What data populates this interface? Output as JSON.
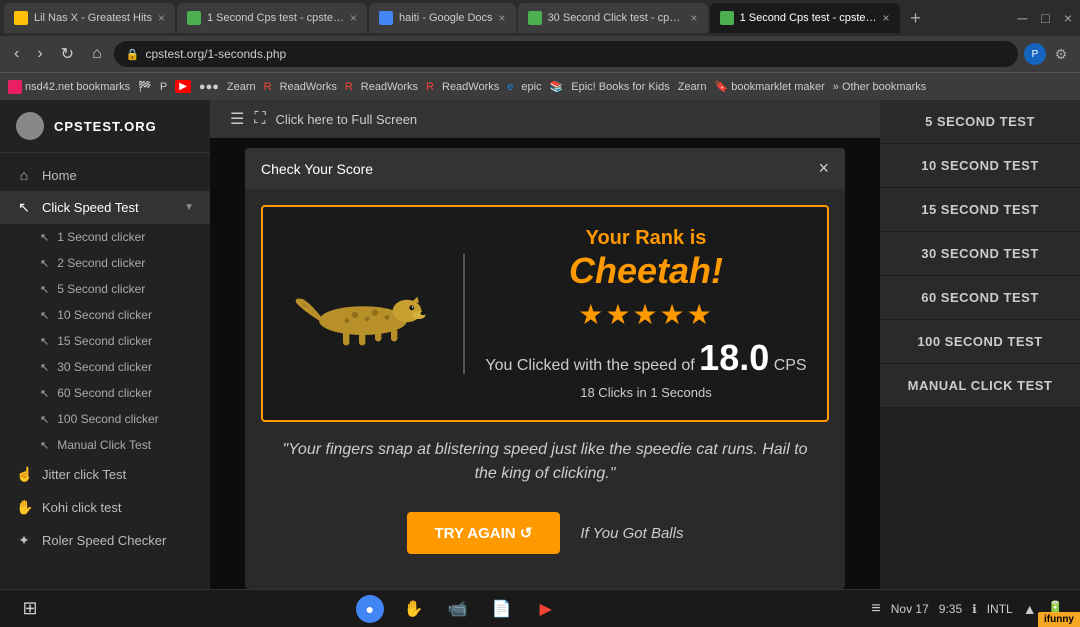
{
  "browser": {
    "tabs": [
      {
        "label": "Lil Nas X - Greatest Hits",
        "favicon": "yellow",
        "active": false
      },
      {
        "label": "1 Second Cps test - cpstest.or...",
        "favicon": "green",
        "active": false
      },
      {
        "label": "haiti - Google Docs",
        "favicon": "blue",
        "active": false
      },
      {
        "label": "30 Second Click test - cpstest...",
        "favicon": "green",
        "active": false
      },
      {
        "label": "1 Second Cps test - cpstest.or...",
        "favicon": "green",
        "active": true
      }
    ],
    "address": "cpstest.org/1-seconds.php",
    "bookmarks": [
      "nsd42.net bookmarks",
      "Zearn",
      "ReadWorks",
      "ReadWorks",
      "ReadWorks",
      "epic",
      "Epic! Books for Kids",
      "Zearn",
      "bookmarklet maker",
      "Other bookmarks"
    ]
  },
  "site": {
    "logo_text": "CPSTEST.ORG",
    "fullscreen_text": "Click here to Full Screen"
  },
  "sidebar": {
    "home_label": "Home",
    "click_speed_label": "Click Speed Test",
    "items": [
      "1 Second clicker",
      "2 Second clicker",
      "5 Second clicker",
      "10 Second clicker",
      "15 Second clicker",
      "30 Second clicker",
      "60 Second clicker",
      "100 Second clicker",
      "Manual Click Test"
    ],
    "jitter_label": "Jitter click Test",
    "kohi_label": "Kohi click test",
    "roller_label": "Roler Speed Checker"
  },
  "right_sidebar": {
    "items": [
      "5 SECOND TEST",
      "10 SECOND TEST",
      "15 SECOND TEST",
      "30 SECOND TEST",
      "60 SECOND TEST",
      "100 SECOND TEST",
      "MANUAL CLICK TEST"
    ]
  },
  "modal": {
    "title": "Check Your Score",
    "rank_label": "Your Rank is",
    "rank_name": "Cheetah!",
    "stars": "★★★★★",
    "speed_prefix": "You Clicked with the speed of",
    "speed_num": "18.0",
    "speed_unit": "CPS",
    "clicks_info": "18 Clicks in 1 Seconds",
    "quote": "\"Your fingers snap at blistering speed just like the speedie cat runs. Hail to the king of clicking.\"",
    "try_again": "TRY AGAIN ↺",
    "if_balls": "If You Got Balls"
  },
  "taskbar": {
    "time": "9:35",
    "date": "Nov 17",
    "network": "INTL",
    "icons": [
      "chrome",
      "touch",
      "camera",
      "docs",
      "play"
    ]
  }
}
